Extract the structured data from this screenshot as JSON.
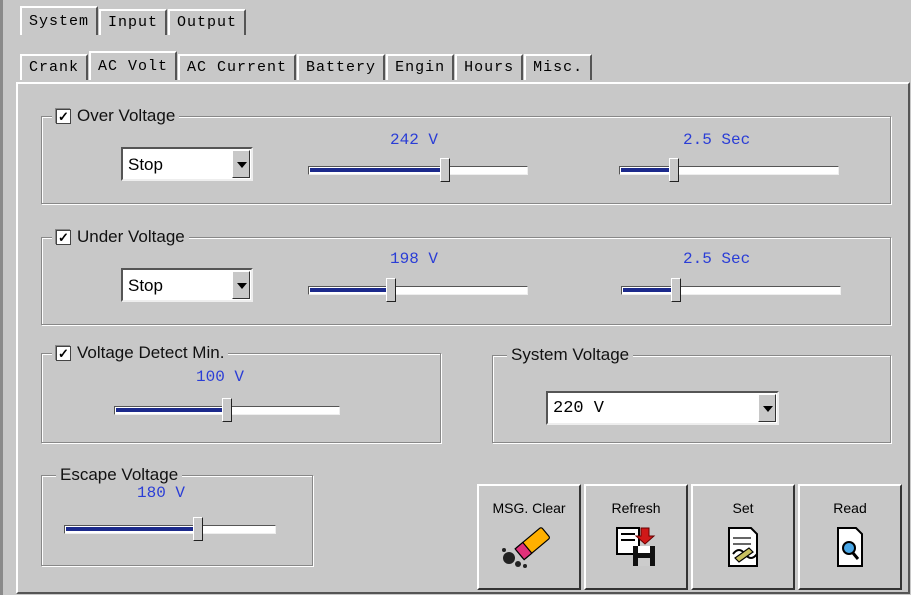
{
  "tabs_top": [
    "System",
    "Input",
    "Output"
  ],
  "tabs_sub": [
    "Crank",
    "AC Volt",
    "AC Current",
    "Battery",
    "Engin",
    "Hours",
    "Misc."
  ],
  "over_voltage": {
    "label": "Over Voltage",
    "checked": true,
    "action": "Stop",
    "voltage": "242 V",
    "voltage_level": 0.63,
    "delay": "2.5 Sec",
    "delay_level": 0.24
  },
  "under_voltage": {
    "label": "Under Voltage",
    "checked": true,
    "action": "Stop",
    "voltage": "198 V",
    "voltage_level": 0.37,
    "delay": "2.5 Sec",
    "delay_level": 0.24
  },
  "detect_min": {
    "label": "Voltage Detect Min.",
    "checked": true,
    "voltage": "100 V",
    "level": 0.5
  },
  "system_voltage": {
    "label": "System Voltage",
    "value": "220 V"
  },
  "escape_voltage": {
    "label": "Escape Voltage",
    "voltage": "180 V",
    "level": 0.64
  },
  "buttons": {
    "msg_clear": "MSG. Clear",
    "refresh": "Refresh",
    "set": "Set",
    "read": "Read"
  },
  "colors": {
    "value_text": "#2a3dd6",
    "slider_fill": "#1c2a8c",
    "window_bg": "#c8c8c8"
  }
}
